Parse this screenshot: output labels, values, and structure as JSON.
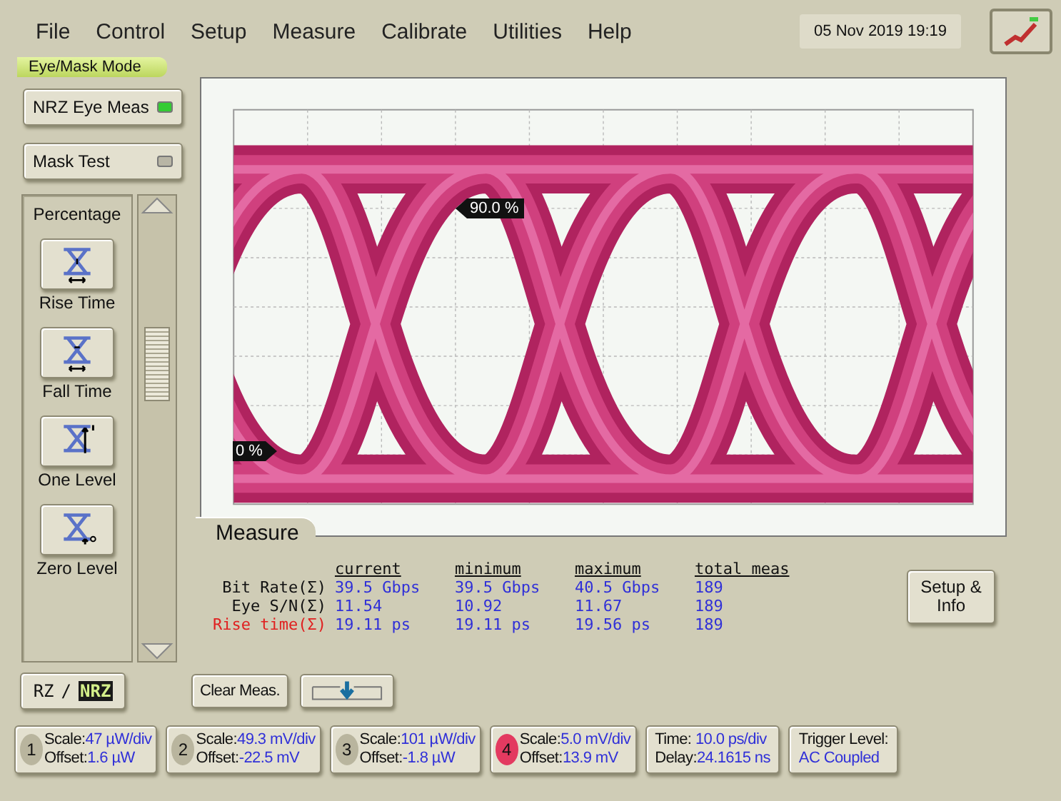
{
  "menu": [
    {
      "label": "File"
    },
    {
      "label": "Control"
    },
    {
      "label": "Setup"
    },
    {
      "label": "Measure"
    },
    {
      "label": "Calibrate"
    },
    {
      "label": "Utilities"
    },
    {
      "label": "Help"
    }
  ],
  "datetime": "05 Nov 2019  19:19",
  "mode_label": "Eye/Mask Mode",
  "modes": [
    {
      "label": "NRZ Eye Meas",
      "on": true
    },
    {
      "label": "Mask Test",
      "on": false
    }
  ],
  "measurements": [
    {
      "label": "Percentage",
      "kind": "text"
    },
    {
      "label": "Rise Time",
      "kind": "rise"
    },
    {
      "label": "Fall Time",
      "kind": "fall"
    },
    {
      "label": "One Level",
      "kind": "one"
    },
    {
      "label": "Zero Level",
      "kind": "zero"
    }
  ],
  "markers": [
    {
      "label": "90.0 %"
    },
    {
      "label": "0 %"
    }
  ],
  "measure_panel": {
    "tab": "Measure",
    "columns": [
      "current",
      "minimum",
      "maximum",
      "total meas"
    ],
    "rows": [
      {
        "label": "Bit Rate(Σ)",
        "selected": false,
        "values": [
          "39.5 Gbps",
          "39.5 Gbps",
          "40.5 Gbps",
          "189"
        ]
      },
      {
        "label": "Eye S/N(Σ)",
        "selected": false,
        "values": [
          "11.54",
          "10.92",
          "11.67",
          "189"
        ]
      },
      {
        "label": "Rise time(Σ)",
        "selected": true,
        "values": [
          "19.11 ps",
          "19.11 ps",
          "19.56 ps",
          "189"
        ]
      }
    ],
    "button": "Setup & Info"
  },
  "format_toggle": {
    "options": [
      {
        "label": "RZ",
        "selected": false
      },
      {
        "label": "NRZ",
        "selected": true
      }
    ],
    "separator": "/"
  },
  "clear_button": "Clear Meas.",
  "channels": [
    {
      "number": "1",
      "scale_label": "Scale:",
      "scale": "47 µW/div",
      "offset_label": "Offset:",
      "offset": "1.6 µW",
      "selected": false
    },
    {
      "number": "2",
      "scale_label": "Scale:",
      "scale": "49.3 mV/div",
      "offset_label": "Offset:",
      "offset": "-22.5 mV",
      "selected": false
    },
    {
      "number": "3",
      "scale_label": "Scale:",
      "scale": "101 µW/div",
      "offset_label": "Offset:",
      "offset": "-1.8 µW",
      "selected": false
    },
    {
      "number": "4",
      "scale_label": "Scale:",
      "scale": "5.0 mV/div",
      "offset_label": "Offset:",
      "offset": "13.9 mV",
      "selected": true
    }
  ],
  "timebase": {
    "time_label": "Time:",
    "time": "10.0 ps/div",
    "delay_label": "Delay:",
    "delay": "24.1615 ns"
  },
  "trigger": {
    "label": "Trigger Level:",
    "value": "AC Coupled"
  }
}
